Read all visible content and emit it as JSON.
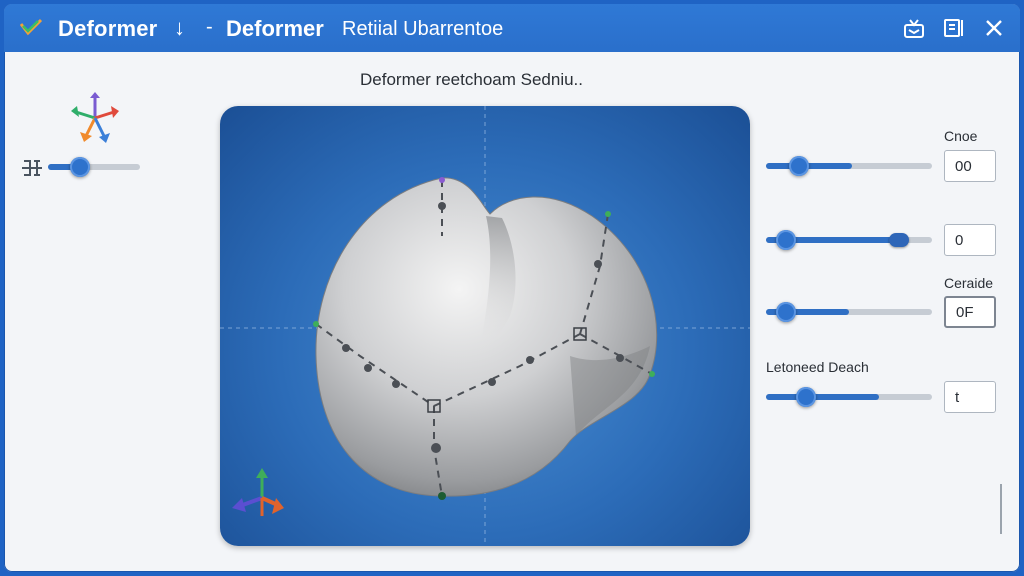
{
  "window": {
    "title": "Deformer",
    "title_arrow": "↓",
    "title_separator": "-",
    "title_secondary": "Deformer",
    "subtitle": "Retiial Ubarrentoe"
  },
  "heading": "Deformer reetchoam Sedniu..",
  "left_panel": {
    "slider": {
      "value": 0.35
    }
  },
  "right_panel": {
    "rows": [
      {
        "label": "Cnoe",
        "input_value": "00",
        "slider": {
          "value": 0.2,
          "fill": 0.52
        }
      },
      {
        "label": "",
        "input_value": "0",
        "slider": {
          "value": 0.12,
          "value2": 0.8,
          "fill": 0.8
        }
      },
      {
        "label": "Ceraide",
        "input_value": "0F",
        "slider": {
          "value": 0.12,
          "fill": 0.5
        }
      },
      {
        "label": "Letoneed Deach",
        "input_value": "t",
        "slider": {
          "value": 0.24,
          "fill": 0.68
        }
      }
    ]
  },
  "colors": {
    "titlebar": "#2f79d6",
    "accent": "#2e72cc",
    "viewport_bg": "#2c6cb8"
  },
  "icons": [
    "deformer-logo-icon",
    "export-icon",
    "panel-icon",
    "close-icon",
    "transform-gizmo-icon",
    "constraint-icon",
    "axis-gizmo-icon"
  ]
}
